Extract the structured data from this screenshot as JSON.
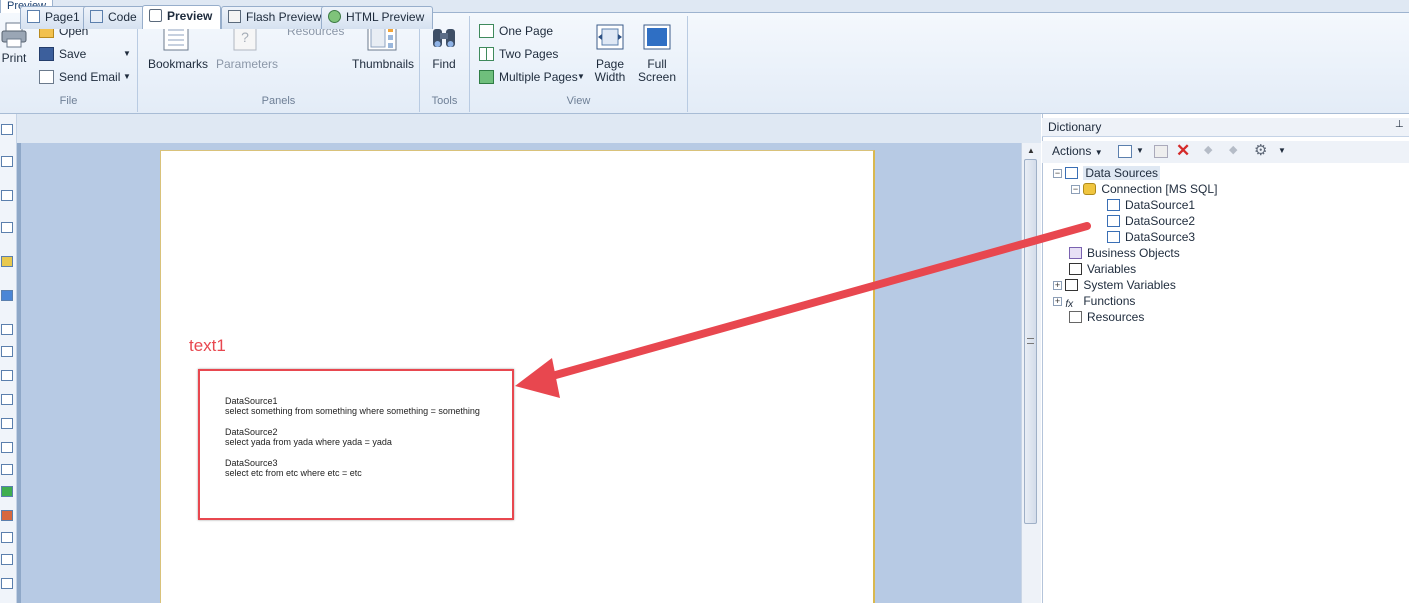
{
  "ribbon": {
    "tab": "Preview",
    "file": {
      "print": "Print",
      "open": "Open",
      "save": "Save",
      "send_email": "Send Email",
      "label": "File"
    },
    "panels": {
      "bookmarks": "Bookmarks",
      "parameters": "Parameters",
      "resources": "Resources",
      "thumbnails": "Thumbnails",
      "label": "Panels"
    },
    "tools": {
      "find": "Find",
      "label": "Tools"
    },
    "view": {
      "one_page": "One Page",
      "two_pages": "Two Pages",
      "multiple_pages": "Multiple Pages",
      "page_width_1": "Page",
      "page_width_2": "Width",
      "full_screen_1": "Full",
      "full_screen_2": "Screen",
      "label": "View"
    }
  },
  "doc_tabs": [
    "Page1",
    "Code",
    "Preview",
    "Flash Preview",
    "HTML Preview"
  ],
  "annotation": {
    "label": "text1",
    "lines": [
      "DataSource1",
      "select something from something where something = something",
      "DataSource2",
      "select yada from yada where yada = yada",
      "DataSource3",
      "select etc from etc where etc = etc"
    ]
  },
  "dictionary": {
    "title": "Dictionary",
    "actions": "Actions",
    "tree": {
      "data_sources": "Data Sources",
      "connection": "Connection [MS SQL]",
      "ds1": "DataSource1",
      "ds2": "DataSource2",
      "ds3": "DataSource3",
      "business_objects": "Business Objects",
      "variables": "Variables",
      "system_variables": "System Variables",
      "functions": "Functions",
      "resources": "Resources"
    }
  },
  "colors": {
    "annotation_red": "#e8474f",
    "ribbon_bg": "#e3ecf7",
    "canvas_bg": "#b7cae4"
  }
}
